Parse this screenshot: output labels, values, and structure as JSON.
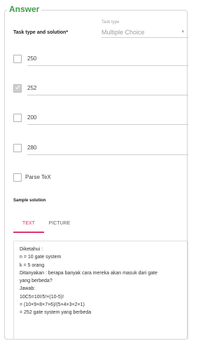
{
  "section": {
    "legend": "Answer"
  },
  "task_type": {
    "label": "Task type and solution*",
    "caption": "Task type",
    "value": "Multiple Choice"
  },
  "options": [
    {
      "value": "250",
      "checked": false
    },
    {
      "value": "252",
      "checked": true
    },
    {
      "value": "200",
      "checked": false
    },
    {
      "value": "280",
      "checked": false
    }
  ],
  "parse_tex": {
    "label": "Parse TeX",
    "checked": false
  },
  "sample_solution": {
    "label": "Sample solution",
    "tabs": [
      "TEXT",
      "PICTURE"
    ],
    "active_tab": "TEXT",
    "lines": [
      "Diketahui :",
      "n = 10 gate system",
      "k = 5 orang",
      "Ditanyakan : berapa banyak cara mereka akan masuk dari gate",
      "yang berbeda?",
      "Jawab:",
      "10C5=10!/5!×(10-5)!",
      "= (10×9×8×7×6)/(5×4×3×2×1)",
      "= 252 gate system yang berbeda"
    ]
  },
  "colors": {
    "accent_green": "#3f9d4a",
    "accent_pink": "#e0316e"
  }
}
